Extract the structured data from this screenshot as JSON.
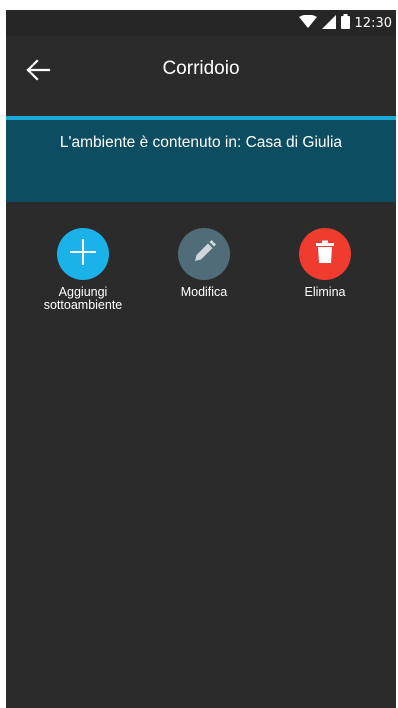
{
  "status_bar": {
    "time": "12:30"
  },
  "app_bar": {
    "title": "Corridoio",
    "back_icon": "arrow-left-icon"
  },
  "context_banner": {
    "text": "L'ambiente è contenuto in: Casa di Giulia"
  },
  "actions": [
    {
      "label": "Aggiungi\nsottoambiente",
      "icon": "plus-icon",
      "color": "#1ab2e8"
    },
    {
      "label": "Modifica",
      "icon": "pencil-icon",
      "color": "#4f6c78"
    },
    {
      "label": "Elimina",
      "icon": "trash-icon",
      "color": "#f03b2f"
    }
  ],
  "colors": {
    "background": "#2b2b2b",
    "accent_line": "#1aa9d6",
    "banner": "#0d4d61",
    "text": "#ffffff"
  }
}
